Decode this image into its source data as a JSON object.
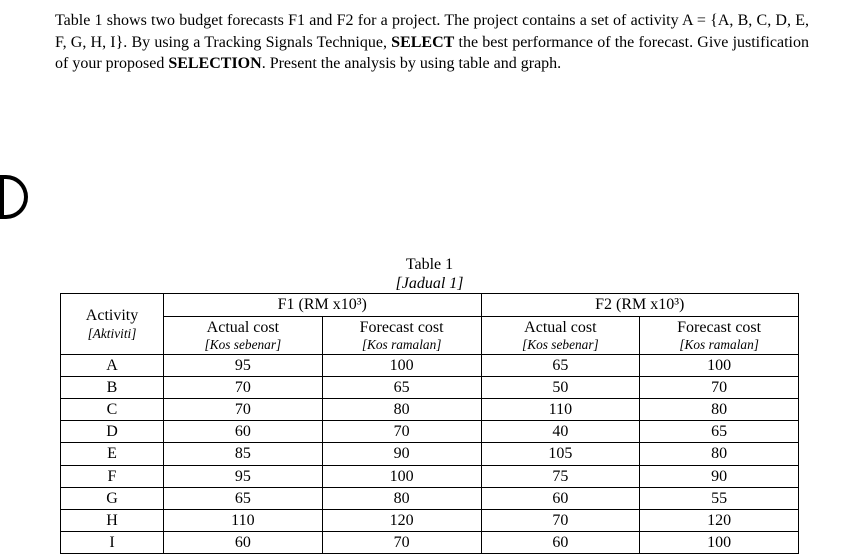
{
  "paragraph": {
    "p1": "Table 1 shows two budget forecasts F1 and F2 for a project. The project contains a set of activity A = {A, B, C, D, E, F, G, H, I}. By using a Tracking Signals Technique, ",
    "b1": "SELECT",
    "p2": " the best performance of the forecast. Give justification of your proposed ",
    "b2": "SELECTION",
    "p3": ". Present the analysis by using table and graph."
  },
  "table": {
    "title": "Table 1",
    "title_it": "[Jadual 1]",
    "headers": {
      "activity": "Activity",
      "activity_it": "[Aktiviti]",
      "f1": "F1 (RM x10³)",
      "f2": "F2 (RM x10³)",
      "actual": "Actual cost",
      "actual_it": "[Kos sebenar]",
      "forecast": "Forecast cost",
      "forecast_it": "[Kos ramalan]"
    },
    "rows": [
      {
        "a": "A",
        "f1a": "95",
        "f1f": "100",
        "f2a": "65",
        "f2f": "100"
      },
      {
        "a": "B",
        "f1a": "70",
        "f1f": "65",
        "f2a": "50",
        "f2f": "70"
      },
      {
        "a": "C",
        "f1a": "70",
        "f1f": "80",
        "f2a": "110",
        "f2f": "80"
      },
      {
        "a": "D",
        "f1a": "60",
        "f1f": "70",
        "f2a": "40",
        "f2f": "65"
      },
      {
        "a": "E",
        "f1a": "85",
        "f1f": "90",
        "f2a": "105",
        "f2f": "80"
      },
      {
        "a": "F",
        "f1a": "95",
        "f1f": "100",
        "f2a": "75",
        "f2f": "90"
      },
      {
        "a": "G",
        "f1a": "65",
        "f1f": "80",
        "f2a": "60",
        "f2f": "55"
      },
      {
        "a": "H",
        "f1a": "110",
        "f1f": "120",
        "f2a": "70",
        "f2f": "120"
      },
      {
        "a": "I",
        "f1a": "60",
        "f1f": "70",
        "f2a": "60",
        "f2f": "100"
      }
    ]
  },
  "chart_data": {
    "type": "table",
    "title": "Table 1 – Budget forecasts F1 and F2 (RM x10³)",
    "columns": [
      "Activity",
      "F1 Actual cost",
      "F1 Forecast cost",
      "F2 Actual cost",
      "F2 Forecast cost"
    ],
    "rows": [
      [
        "A",
        95,
        100,
        65,
        100
      ],
      [
        "B",
        70,
        65,
        50,
        70
      ],
      [
        "C",
        70,
        80,
        110,
        80
      ],
      [
        "D",
        60,
        70,
        40,
        65
      ],
      [
        "E",
        85,
        90,
        105,
        80
      ],
      [
        "F",
        95,
        100,
        75,
        90
      ],
      [
        "G",
        65,
        80,
        60,
        55
      ],
      [
        "H",
        110,
        120,
        70,
        120
      ],
      [
        "I",
        60,
        70,
        60,
        100
      ]
    ]
  }
}
